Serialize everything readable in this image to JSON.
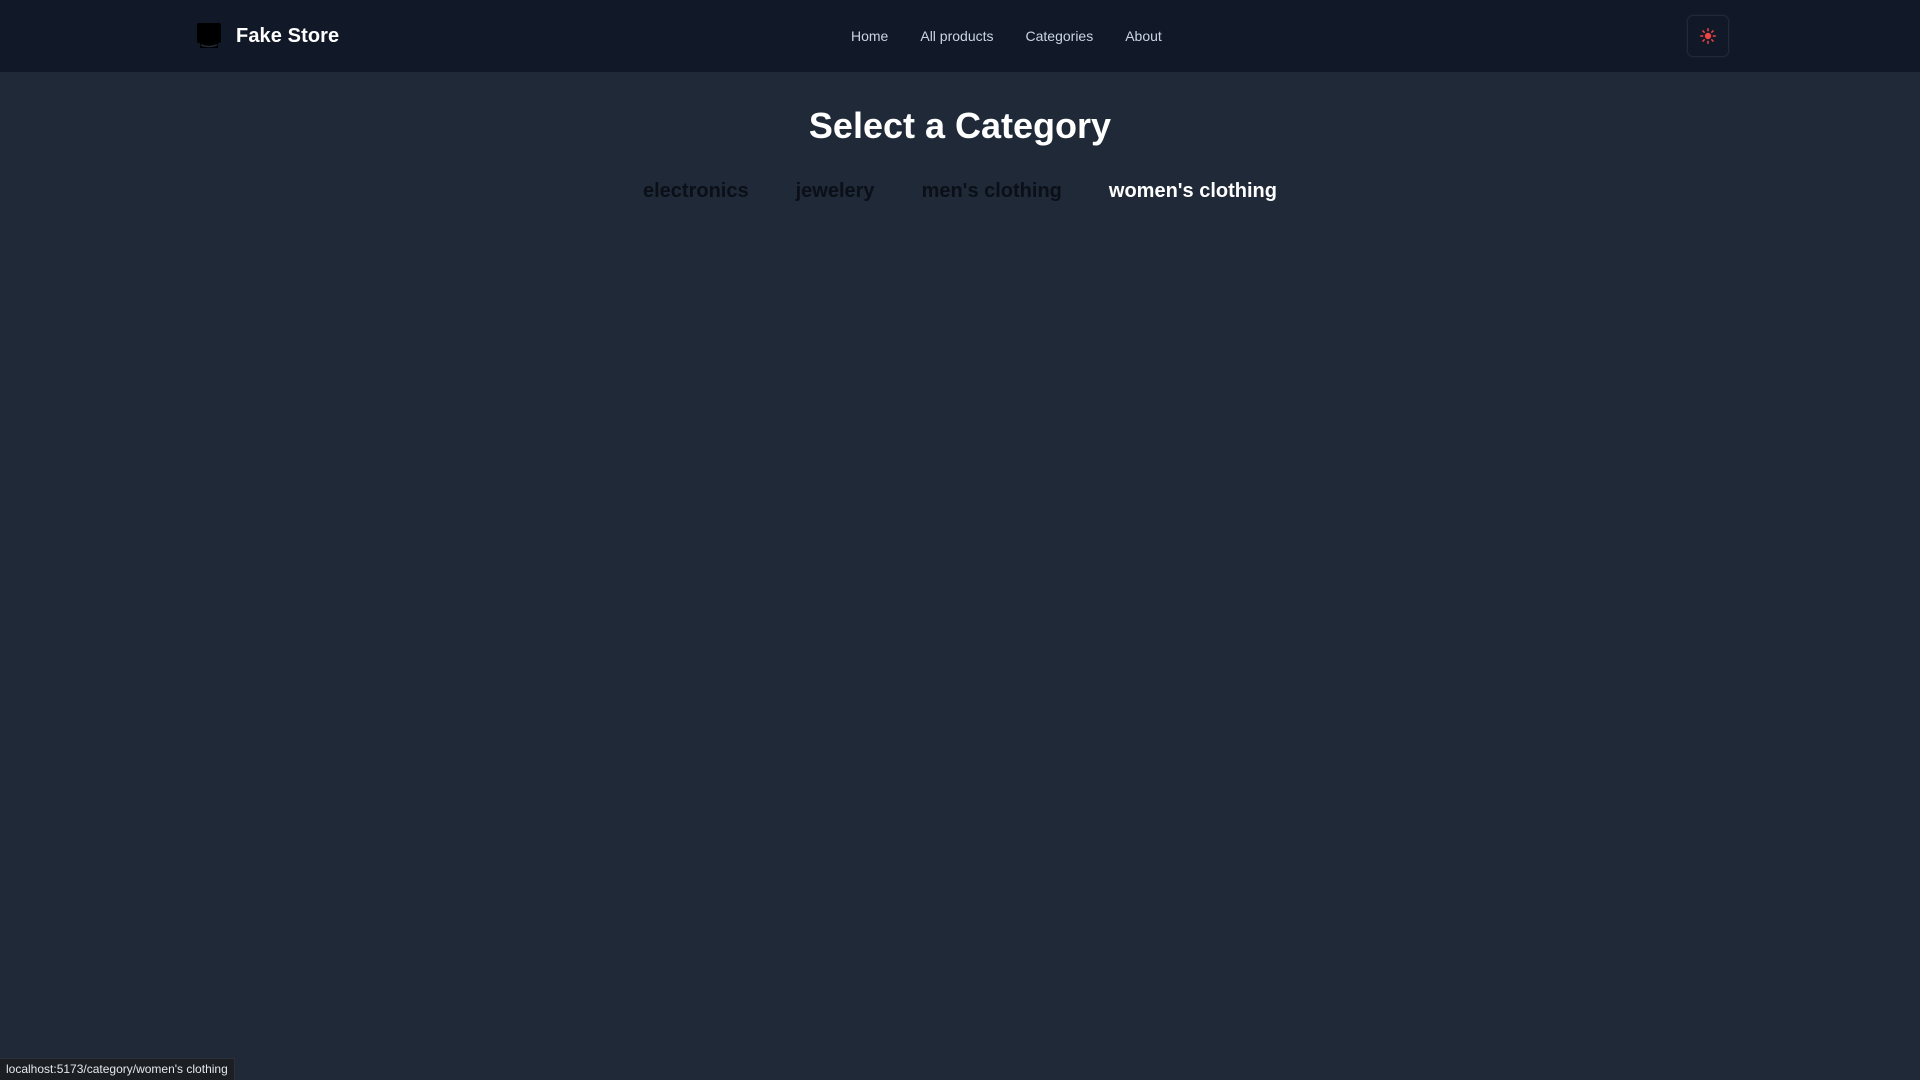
{
  "navbar": {
    "brand": {
      "name": "Fake Store",
      "logo_icon": "storefront-icon"
    },
    "links": [
      {
        "label": "Home"
      },
      {
        "label": "All products"
      },
      {
        "label": "Categories"
      },
      {
        "label": "About"
      }
    ],
    "theme_toggle_icon": "sun-icon",
    "theme_toggle_color": "#ef4444"
  },
  "main": {
    "title": "Select a Category",
    "categories": [
      {
        "label": "electronics",
        "active": false
      },
      {
        "label": "jewelery",
        "active": false
      },
      {
        "label": "men's clothing",
        "active": false
      },
      {
        "label": "women's clothing",
        "active": true
      }
    ]
  },
  "status_bar": {
    "url": "localhost:5173/category/women's clothing"
  },
  "colors": {
    "page_background": "#1f2937",
    "navbar_background": "#111827",
    "active_category": "#ffffff",
    "inactive_category": "#0b0f17"
  }
}
